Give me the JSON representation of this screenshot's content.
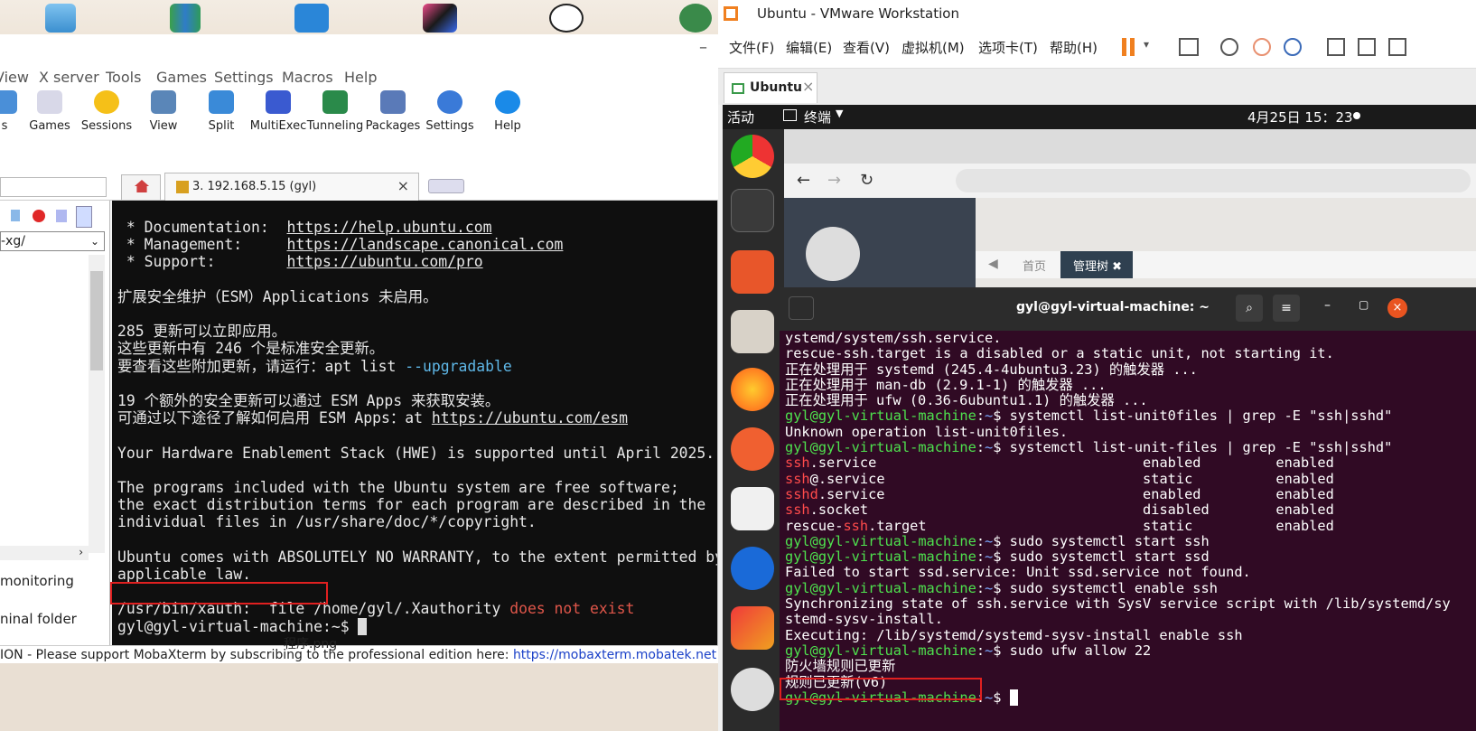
{
  "moba": {
    "menu": [
      "View",
      "X server",
      "Tools",
      "Games",
      "Settings",
      "Macros",
      "Help"
    ],
    "toolbar": [
      {
        "label": "s",
        "icon": "partial-icon"
      },
      {
        "label": "Games",
        "icon": "games-icon"
      },
      {
        "label": "Sessions",
        "icon": "star-icon"
      },
      {
        "label": "View",
        "icon": "monitor-icon"
      },
      {
        "label": "Split",
        "icon": "split-icon"
      },
      {
        "label": "MultiExec",
        "icon": "fork-icon"
      },
      {
        "label": "Tunneling",
        "icon": "tunnel-icon"
      },
      {
        "label": "Packages",
        "icon": "package-icon"
      },
      {
        "label": "Settings",
        "icon": "gear-icon"
      },
      {
        "label": "Help",
        "icon": "help-icon"
      }
    ],
    "tab_title": "3. 192.168.5.15 (gyl)",
    "side_path": "-xg/",
    "side_items": [
      "monitoring",
      "ninal folder"
    ],
    "terminal": {
      "doc_label": " * Documentation:  ",
      "doc_url": "https://help.ubuntu.com",
      "mgmt_label": " * Management:     ",
      "mgmt_url": "https://landscape.canonical.com",
      "support_label": " * Support:        ",
      "support_url": "https://ubuntu.com/pro",
      "esm_line": "扩展安全维护（ESM）Applications 未启用。",
      "upd1": "285 更新可以立即应用。",
      "upd2": "这些更新中有 246 个是标准安全更新。",
      "upd3": "要查看这些附加更新，请运行：apt list ",
      "upd3_flag": "--upgradable",
      "esm2a": "19 个额外的安全更新可以通过 ESM Apps 来获取安装。",
      "esm2b": "可通过以下途径了解如何启用 ESM Apps：at ",
      "esm2b_url": "https://ubuntu.com/esm",
      "hwe": "Your Hardware Enablement Stack (HWE) is supported until April 2025.",
      "free1": "The programs included with the Ubuntu system are free software;",
      "free2": "the exact distribution terms for each program are described in the",
      "free3": "individual files in /usr/share/doc/*/copyright.",
      "warr1": "Ubuntu comes with ABSOLUTELY NO WARRANTY, to the extent permitted by",
      "warr2": "applicable law.",
      "xauth": "/usr/bin/xauth:  file /home/gyl/.Xauthority ",
      "xauth_err": "does not exist",
      "prompt": "gyl@gyl-virtual-machine:~$"
    },
    "status": {
      "prefix": "ION  -  Please support MobaXterm by subscribing to the professional edition here:  ",
      "link": "https://mobaxterm.mobatek.net"
    },
    "desktop_caption": "程序.png"
  },
  "vmware": {
    "title": "Ubuntu - VMware Workstation",
    "menu": [
      "文件(F)",
      "编辑(E)",
      "查看(V)",
      "虚拟机(M)",
      "选项卡(T)",
      "帮助(H)"
    ],
    "tab": "Ubuntu",
    "gnome": {
      "activities": "活动",
      "terminal_menu": "终端",
      "clock": "4月25日  15：23"
    },
    "browser_tabs": [
      "首页",
      "管理树"
    ],
    "term_title": "gyl@gyl-virtual-machine: ~",
    "lines": [
      {
        "t": "ystemd/system/ssh.service."
      },
      {
        "t": "rescue-ssh.target is a disabled or a static unit, not starting it."
      },
      {
        "t": "正在处理用于 systemd (245.4-4ubuntu3.23) 的触发器 ..."
      },
      {
        "t": "正在处理用于 man-db (2.9.1-1) 的触发器 ..."
      },
      {
        "t": "正在处理用于 ufw (0.36-6ubuntu1.1) 的触发器 ..."
      },
      {
        "p": "gyl@gyl-virtual-machine",
        "c": "$ systemctl list-unit0files | grep -E \"ssh|sshd\""
      },
      {
        "t": "Unknown operation list-unit0files."
      },
      {
        "p": "gyl@gyl-virtual-machine",
        "c": "$ systemctl list-unit-files | grep -E \"ssh|sshd\""
      },
      {
        "u": "ssh",
        "r": ".service",
        "a": "enabled",
        "b": "enabled"
      },
      {
        "u": "ssh",
        "r": "@.service",
        "a": "static",
        "b": "enabled"
      },
      {
        "u": "sshd",
        "r": ".service",
        "a": "enabled",
        "b": "enabled"
      },
      {
        "u": "ssh",
        "r": ".socket",
        "a": "disabled",
        "b": "enabled"
      },
      {
        "pre": "rescue-",
        "u": "ssh",
        "r": ".target",
        "a": "static",
        "b": "enabled"
      },
      {
        "p": "gyl@gyl-virtual-machine",
        "c": "$ sudo systemctl start ssh"
      },
      {
        "p": "gyl@gyl-virtual-machine",
        "c": "$ sudo systemctl start ssd"
      },
      {
        "t": "Failed to start ssd.service: Unit ssd.service not found."
      },
      {
        "p": "gyl@gyl-virtual-machine",
        "c": "$ sudo systemctl enable ssh"
      },
      {
        "t": "Synchronizing state of ssh.service with SysV service script with /lib/systemd/sy"
      },
      {
        "t": "stemd-sysv-install."
      },
      {
        "t": "Executing: /lib/systemd/systemd-sysv-install enable ssh"
      },
      {
        "p": "gyl@gyl-virtual-machine",
        "c": "$ sudo ufw allow 22"
      },
      {
        "t": "防火墙规则已更新"
      },
      {
        "t": "规则已更新(v6)"
      },
      {
        "p": "gyl@gyl-virtual-machine",
        "c": "$ "
      }
    ]
  }
}
